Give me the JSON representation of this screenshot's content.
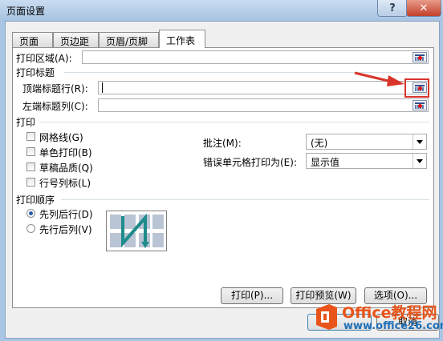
{
  "window": {
    "title": "页面设置",
    "help": "?",
    "close": "✕"
  },
  "tabs": [
    "页面",
    "页边距",
    "页眉/页脚",
    "工作表"
  ],
  "print_area": {
    "label": "打印区域(A):",
    "value": ""
  },
  "print_titles": {
    "heading": "打印标题",
    "top_rows_label": "顶端标题行(R):",
    "top_rows_value": "",
    "left_cols_label": "左端标题列(C):",
    "left_cols_value": ""
  },
  "print": {
    "heading": "打印",
    "options": [
      "网格线(G)",
      "单色打印(B)",
      "草稿品质(Q)",
      "行号列标(L)"
    ],
    "comments_label": "批注(M):",
    "comments_value": "(无)",
    "errors_label": "错误单元格打印为(E):",
    "errors_value": "显示值"
  },
  "page_order": {
    "heading": "打印顺序",
    "options": [
      "先列后行(D)",
      "先行后列(V)"
    ],
    "selected": 0
  },
  "buttons": {
    "print": "打印(P)...",
    "preview": "打印预览(W)",
    "options": "选项(O)...",
    "cancel": "取消"
  },
  "watermark": {
    "brand": "Office教程网",
    "url": "www.office26.com"
  },
  "colors": {
    "annotation": "#d9342b",
    "watermark_orange": "#e8541a"
  }
}
